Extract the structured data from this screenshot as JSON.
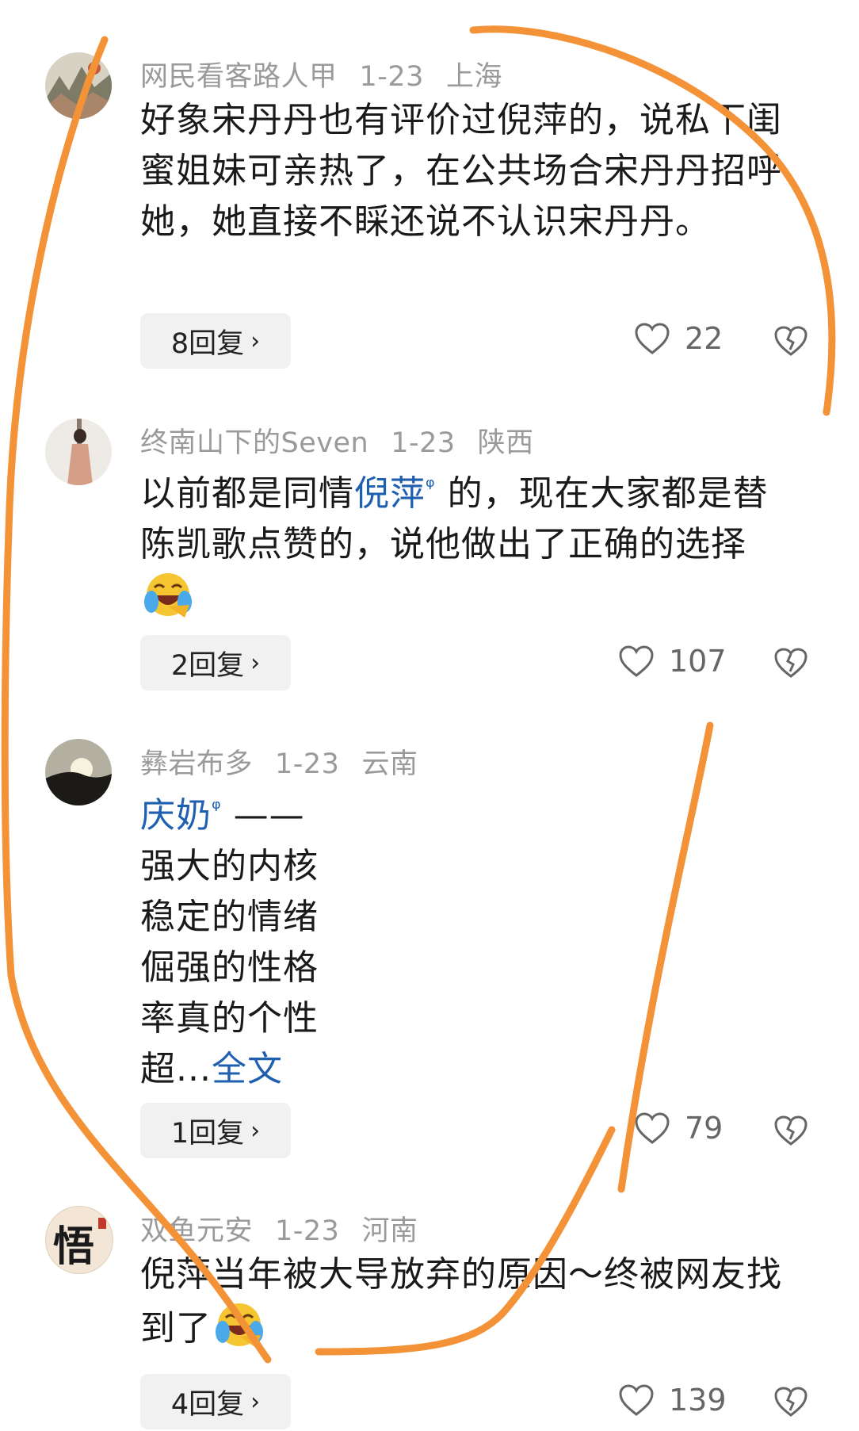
{
  "comments": [
    {
      "user": "网民看客路人甲",
      "date": "1-23",
      "location": "上海",
      "text": "好象宋丹丹也有评价过倪萍的，说私下闺蜜姐妹可亲热了，在公共场合宋丹丹招呼她，她直接不睬还说不认识宋丹丹。",
      "replies": "8回复",
      "likes": "22"
    },
    {
      "user": "终南山下的Seven",
      "date": "1-23",
      "location": "陕西",
      "text_pre": "以前都是同情",
      "text_link": "倪萍",
      "text_post": " 的，现在大家都是替陈凯歌点赞的，说他做出了正确的选择",
      "replies": "2回复",
      "likes": "107"
    },
    {
      "user": "彝岩布多",
      "date": "1-23",
      "location": "云南",
      "text_link": "庆奶",
      "text_dash": " ——",
      "lines": [
        "强大的内核",
        "稳定的情绪",
        "倔强的性格",
        "率真的个性"
      ],
      "text_last": "超...",
      "more_label": "全文",
      "replies": "1回复",
      "likes": "79"
    },
    {
      "user": "双鱼元安",
      "date": "1-23",
      "location": "河南",
      "avatar_text": "悟",
      "text": "倪萍当年被大导放弃的原因～终被网友找到了",
      "replies": "4回复",
      "likes": "139"
    }
  ],
  "colors": {
    "annotation": "#f39237",
    "link": "#1f5fb0",
    "meta": "#9a9a9a"
  }
}
